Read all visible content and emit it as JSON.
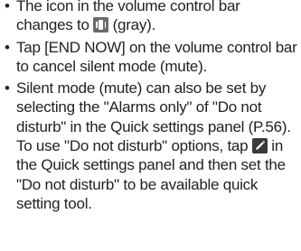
{
  "bullets": [
    {
      "parts": [
        "The icon in the volume control bar changes to ",
        " (gray)."
      ],
      "icon": "vibrate-icon"
    },
    {
      "text": "Tap [END NOW] on the volume control bar to cancel silent mode (mute)."
    },
    {
      "parts": [
        "Silent mode (mute) can also be set by selecting the \"Alarms only\" of \"Do not disturb\" in the Quick settings panel (P.56). To use \"Do not disturb\" options, tap ",
        " in the Quick settings panel and then set the \"Do not disturb\" to be available quick setting tool."
      ],
      "icon": "edit-pencil-icon"
    }
  ],
  "bullet_glyph": "•",
  "colors": {
    "text": "#222222",
    "vibrate_icon_bg": "#6b6b6b",
    "edit_icon_bg": "#3a3a3a"
  }
}
